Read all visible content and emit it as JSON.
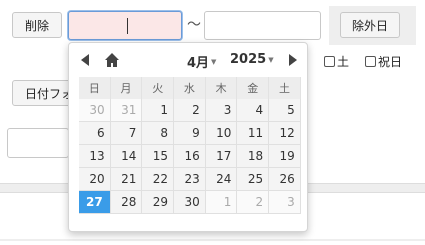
{
  "toolbar": {
    "delete_label": "削除",
    "range_separator": "〜",
    "date_from_value": "",
    "date_to_value": "",
    "exclude_label": "除外日",
    "date_format_label": "日付フォ"
  },
  "checkboxes": [
    {
      "label": "土",
      "checked": false
    },
    {
      "label": "祝日",
      "checked": false
    }
  ],
  "calendar": {
    "month_label": "4月",
    "year_label": "2025",
    "weekday_headers": [
      "日",
      "月",
      "火",
      "水",
      "木",
      "金",
      "土"
    ],
    "weeks": [
      [
        {
          "day": "30",
          "other": true
        },
        {
          "day": "31",
          "other": true
        },
        {
          "day": "1"
        },
        {
          "day": "2"
        },
        {
          "day": "3"
        },
        {
          "day": "4"
        },
        {
          "day": "5"
        }
      ],
      [
        {
          "day": "6"
        },
        {
          "day": "7"
        },
        {
          "day": "8"
        },
        {
          "day": "9"
        },
        {
          "day": "10"
        },
        {
          "day": "11"
        },
        {
          "day": "12"
        }
      ],
      [
        {
          "day": "13"
        },
        {
          "day": "14"
        },
        {
          "day": "15"
        },
        {
          "day": "16"
        },
        {
          "day": "17"
        },
        {
          "day": "18"
        },
        {
          "day": "19"
        }
      ],
      [
        {
          "day": "20"
        },
        {
          "day": "21"
        },
        {
          "day": "22"
        },
        {
          "day": "23"
        },
        {
          "day": "24"
        },
        {
          "day": "25"
        },
        {
          "day": "26"
        }
      ],
      [
        {
          "day": "27",
          "selected": true
        },
        {
          "day": "28"
        },
        {
          "day": "29"
        },
        {
          "day": "30"
        },
        {
          "day": "1",
          "other": true
        },
        {
          "day": "2",
          "other": true
        },
        {
          "day": "3",
          "other": true
        }
      ]
    ],
    "accent_color": "#3a9ce8"
  },
  "icons": {
    "prev": "triangle-left-icon",
    "home": "home-icon",
    "next": "triangle-right-icon"
  }
}
